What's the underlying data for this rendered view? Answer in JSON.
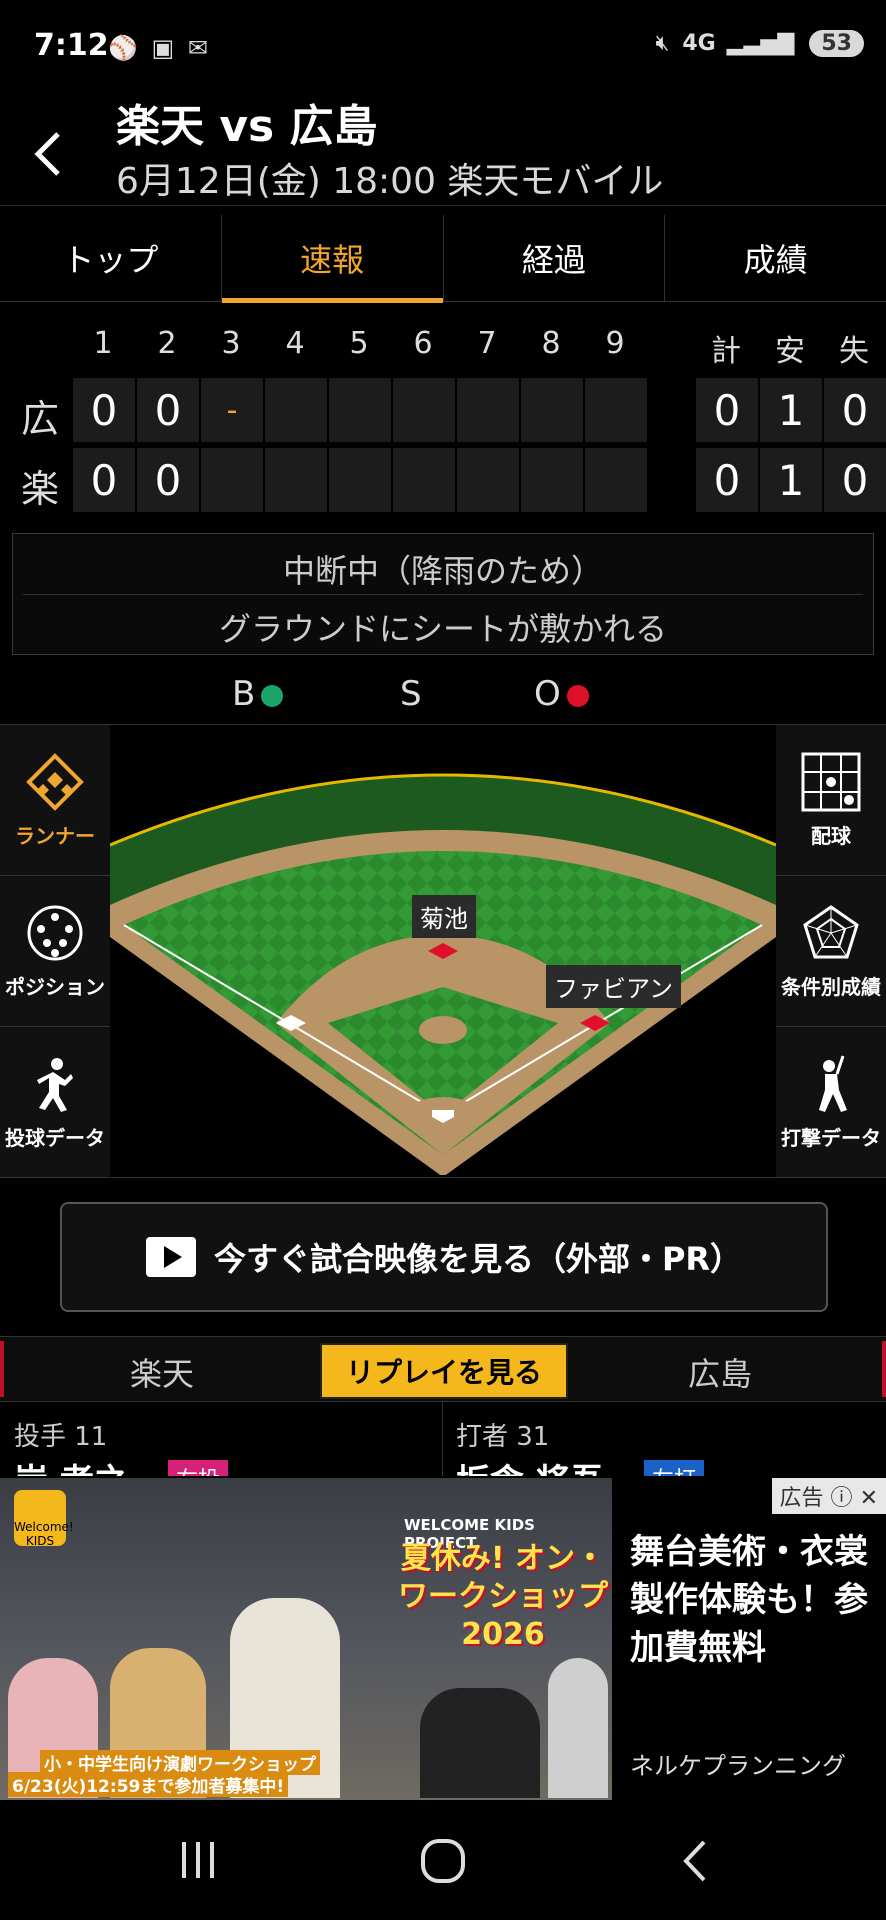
{
  "status_bar": {
    "time": "7:12",
    "left_icons": [
      "baseball-icon",
      "screenshot-icon",
      "notification-icon"
    ],
    "network": "4G",
    "battery": "53"
  },
  "header": {
    "title": "楽天 vs 広島",
    "subtitle": "6月12日(金) 18:00 楽天モバイル"
  },
  "tabs": [
    {
      "label": "トップ",
      "active": false
    },
    {
      "label": "速報",
      "active": true
    },
    {
      "label": "経過",
      "active": false
    },
    {
      "label": "成績",
      "active": false
    }
  ],
  "scoreboard": {
    "innings": [
      "1",
      "2",
      "3",
      "4",
      "5",
      "6",
      "7",
      "8",
      "9"
    ],
    "totals_headers": [
      "計",
      "安",
      "失"
    ],
    "rows": [
      {
        "team": "広",
        "innings": [
          "0",
          "0",
          "-",
          "",
          "",
          "",
          "",
          "",
          ""
        ],
        "totals": [
          "0",
          "1",
          "0"
        ]
      },
      {
        "team": "楽",
        "innings": [
          "0",
          "0",
          "",
          "",
          "",
          "",
          "",
          "",
          ""
        ],
        "totals": [
          "0",
          "1",
          "0"
        ]
      }
    ]
  },
  "notice": {
    "line1": "中断中（降雨のため）",
    "line2": "グラウンドにシートが敷かれる"
  },
  "count": {
    "b_label": "B",
    "s_label": "S",
    "o_label": "O",
    "balls": 1,
    "strikes": 0,
    "outs": 1,
    "ball_color": "#1aa36b",
    "out_color": "#e0102a"
  },
  "left_menu": [
    {
      "label": "ランナー",
      "icon": "runner-diamond-icon",
      "active": true
    },
    {
      "label": "ポジション",
      "icon": "position-icon",
      "active": false
    },
    {
      "label": "投球データ",
      "icon": "pitcher-icon",
      "active": false
    }
  ],
  "right_menu": [
    {
      "label": "配球",
      "icon": "pitch-grid-icon"
    },
    {
      "label": "条件別成績",
      "icon": "radar-chart-icon"
    },
    {
      "label": "打撃データ",
      "icon": "batter-icon"
    }
  ],
  "field": {
    "runner_second": "菊池",
    "runner_first": "ファビアン"
  },
  "watch_button": "今すぐ試合映像を見る（外部・PR）",
  "replay": {
    "left_team": "楽天",
    "button": "リプレイを見る",
    "right_team": "広島"
  },
  "players": {
    "pitcher_label": "投手 11",
    "pitcher_name": "岸 孝之",
    "pitcher_badge": "右投",
    "batter_label": "打者 31",
    "batter_name": "坂倉 将吾",
    "batter_badge": "左打"
  },
  "ad": {
    "tag": "広告",
    "image_logo": "Welcome! KIDS",
    "image_headline": "夏休み! オン・ワークショップ 2026",
    "image_project": "WELCOME KIDS PROJECT",
    "image_caption1": "小・中学生向け演劇ワークショップ",
    "image_caption2": "6/23(火)12:59まで参加者募集中!",
    "headline": "舞台美術・衣裳製作体験も！参加費無料",
    "sponsor": "ネルケプランニング"
  }
}
